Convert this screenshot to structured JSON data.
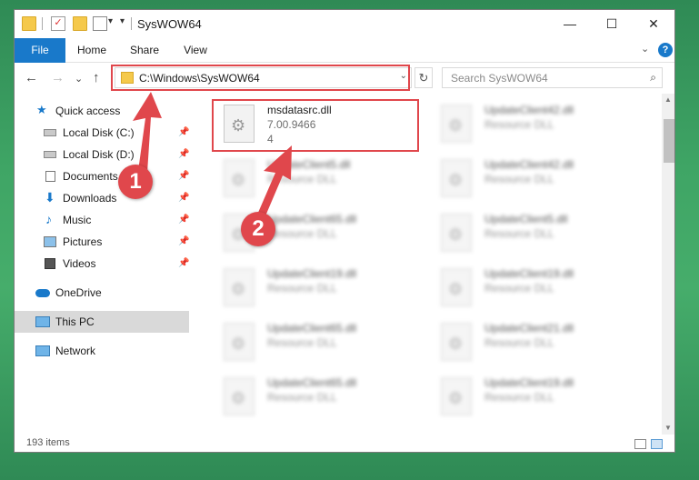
{
  "window": {
    "title": "SysWOW64",
    "controls": {
      "minimize": "—",
      "maximize": "☐",
      "close": "✕"
    }
  },
  "ribbon": {
    "tabs": [
      "File",
      "Home",
      "Share",
      "View"
    ],
    "help": "?",
    "collapse": "⌄"
  },
  "nav": {
    "back": "←",
    "forward": "→",
    "recent": "⌄",
    "up": "↑",
    "address": "C:\\Windows\\SysWOW64",
    "refresh": "↻",
    "search_placeholder": "Search SysWOW64",
    "search_icon": "⌕"
  },
  "sidebar": {
    "items": [
      {
        "label": "Quick access",
        "icon": "star-icon",
        "pinned": false
      },
      {
        "label": "Local Disk (C:)",
        "icon": "drive-icon",
        "pinned": true
      },
      {
        "label": "Local Disk (D:)",
        "icon": "drive-icon",
        "pinned": true
      },
      {
        "label": "Documents",
        "icon": "documents-icon",
        "pinned": true
      },
      {
        "label": "Downloads",
        "icon": "download-arrow-icon",
        "pinned": true
      },
      {
        "label": "Music",
        "icon": "music-note-icon",
        "pinned": true
      },
      {
        "label": "Pictures",
        "icon": "pictures-icon",
        "pinned": true
      },
      {
        "label": "Videos",
        "icon": "film-icon",
        "pinned": true
      },
      {
        "label": "OneDrive",
        "icon": "cloud-icon",
        "pinned": false
      },
      {
        "label": "This PC",
        "icon": "monitor-icon",
        "pinned": false,
        "selected": true
      },
      {
        "label": "Network",
        "icon": "network-icon",
        "pinned": false
      }
    ],
    "pin_glyph": "📌"
  },
  "files": [
    {
      "name": "msdatasrc.dll",
      "line2": "7.00.9466",
      "line3": "4",
      "blurred": false
    },
    {
      "name": "UpdateClient42.dll",
      "line2": "Resource DLL",
      "blurred": true
    },
    {
      "name": "UpdateClient5.dll",
      "line2": "Resource DLL",
      "blurred": true
    },
    {
      "name": "UpdateClient42.dll",
      "line2": "Resource DLL",
      "blurred": true
    },
    {
      "name": "UpdateClient65.dll",
      "line2": "Resource DLL",
      "blurred": true
    },
    {
      "name": "UpdateClient5.dll",
      "line2": "Resource DLL",
      "blurred": true
    },
    {
      "name": "UpdateClient19.dll",
      "line2": "Resource DLL",
      "blurred": true
    },
    {
      "name": "UpdateClient19.dll",
      "line2": "Resource DLL",
      "blurred": true
    },
    {
      "name": "UpdateClient65.dll",
      "line2": "Resource DLL",
      "blurred": true
    },
    {
      "name": "UpdateClient21.dll",
      "line2": "Resource DLL",
      "blurred": true
    },
    {
      "name": "UpdateClient65.dll",
      "line2": "Resource DLL",
      "blurred": true
    },
    {
      "name": "UpdateClient19.dll",
      "line2": "Resource DLL",
      "blurred": true
    }
  ],
  "status": {
    "item_count": "193 items"
  },
  "annotations": {
    "badge1": "1",
    "badge2": "2",
    "color": "#e0474c"
  },
  "colors": {
    "accent": "#1979ca",
    "folder": "#f5c94b",
    "highlight_red": "#e0474c",
    "desktop_green": "#3fa565"
  }
}
